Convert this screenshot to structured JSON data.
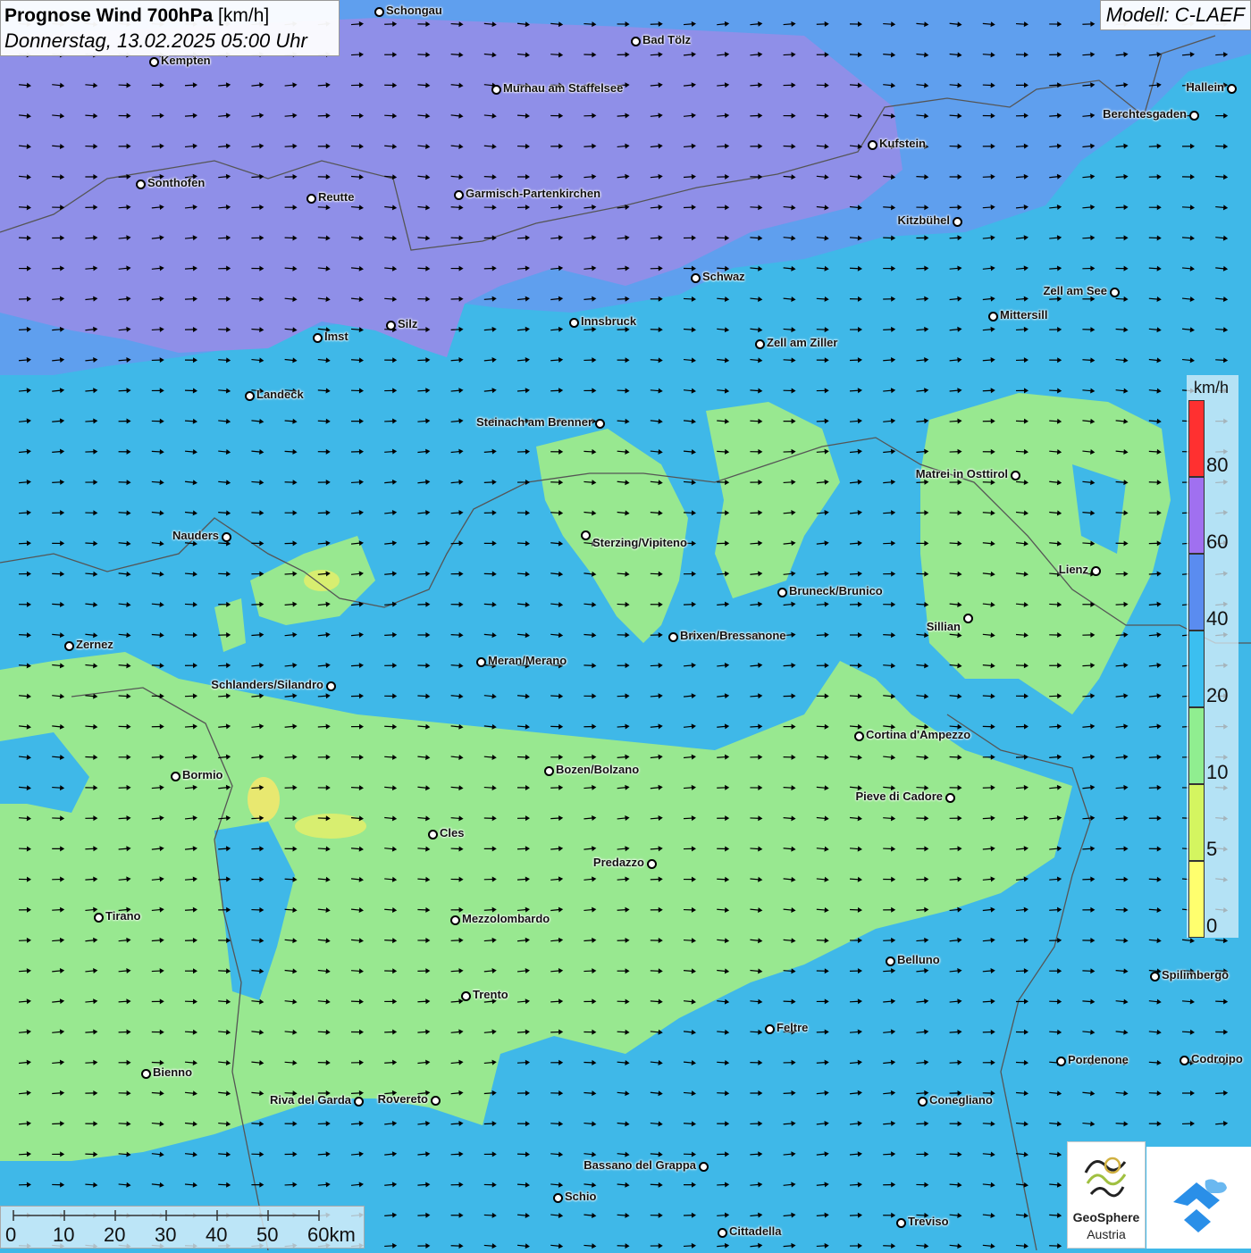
{
  "header": {
    "title_bold": "Prognose Wind 700hPa",
    "title_unit": "[km/h]",
    "subtitle": "Donnerstag, 13.02.2025 05:00 Uhr",
    "model": "Modell: C-LAEF"
  },
  "colors": {
    "purple_zone": "#8f8fe8",
    "blue_zone": "#5f9fee",
    "cyan_zone": "#3fb8e8",
    "green_zone": "#98e890",
    "yellow_zone": "#e8e870",
    "arrow": "#000000",
    "border": "#555555"
  },
  "legend": {
    "unit": "km/h",
    "bins": [
      {
        "from": 0,
        "to": 5,
        "color": "#ffff6e"
      },
      {
        "from": 5,
        "to": 10,
        "color": "#d4f560"
      },
      {
        "from": 10,
        "to": 20,
        "color": "#90ee90"
      },
      {
        "from": 20,
        "to": 40,
        "color": "#3bbff0"
      },
      {
        "from": 40,
        "to": 60,
        "color": "#5a8cf0"
      },
      {
        "from": 60,
        "to": 80,
        "color": "#a070f0"
      },
      {
        "from": 80,
        "to": 100,
        "color": "#ff3030"
      }
    ],
    "labels": [
      "0",
      "5",
      "10",
      "20",
      "40",
      "60",
      "80"
    ]
  },
  "scale": {
    "labels": [
      "0",
      "10",
      "20",
      "30",
      "40",
      "50",
      "60km"
    ]
  },
  "logo": {
    "name": "GeoSphere",
    "sub": "Austria",
    "icon": "geosphere-logo-icon",
    "icon2": "cloud-drop-icon"
  },
  "cities": [
    {
      "name": "Schongau"
    },
    {
      "name": "Bad Tölz"
    },
    {
      "name": "Kempten"
    },
    {
      "name": "Murnau am Staffelsee"
    },
    {
      "name": "Hallein"
    },
    {
      "name": "Berchtesgaden"
    },
    {
      "name": "Kufstein"
    },
    {
      "name": "Sonthofen"
    },
    {
      "name": "Reutte"
    },
    {
      "name": "Garmisch-Partenkirchen"
    },
    {
      "name": "Kitzbühel"
    },
    {
      "name": "Schwaz"
    },
    {
      "name": "Zell am See"
    },
    {
      "name": "Mittersill"
    },
    {
      "name": "Innsbruck"
    },
    {
      "name": "Silz"
    },
    {
      "name": "Imst"
    },
    {
      "name": "Zell am Ziller"
    },
    {
      "name": "Landeck"
    },
    {
      "name": "Steinach am Brenner"
    },
    {
      "name": "Matrei in Osttirol"
    },
    {
      "name": "Nauders"
    },
    {
      "name": "Sterzing/Vipiteno"
    },
    {
      "name": "Lienz"
    },
    {
      "name": "Bruneck/Brunico"
    },
    {
      "name": "Sillian"
    },
    {
      "name": "Brixen/Bressanone"
    },
    {
      "name": "Zernez"
    },
    {
      "name": "Meran/Merano"
    },
    {
      "name": "Schlanders/Silandro"
    },
    {
      "name": "Cortina d'Ampezzo"
    },
    {
      "name": "Bozen/Bolzano"
    },
    {
      "name": "Bormio"
    },
    {
      "name": "Pieve di Cadore"
    },
    {
      "name": "Cles"
    },
    {
      "name": "Predazzo"
    },
    {
      "name": "Tirano"
    },
    {
      "name": "Mezzolombardo"
    },
    {
      "name": "Belluno"
    },
    {
      "name": "Spilimbergo"
    },
    {
      "name": "Trento"
    },
    {
      "name": "Feltre"
    },
    {
      "name": "Pordenone"
    },
    {
      "name": "Codroipo"
    },
    {
      "name": "Bienno"
    },
    {
      "name": "Riva del Garda"
    },
    {
      "name": "Rovereto"
    },
    {
      "name": "Conegliano"
    },
    {
      "name": "Bassano del Grappa"
    },
    {
      "name": "Schio"
    },
    {
      "name": "Treviso"
    },
    {
      "name": "Cittadella"
    }
  ]
}
